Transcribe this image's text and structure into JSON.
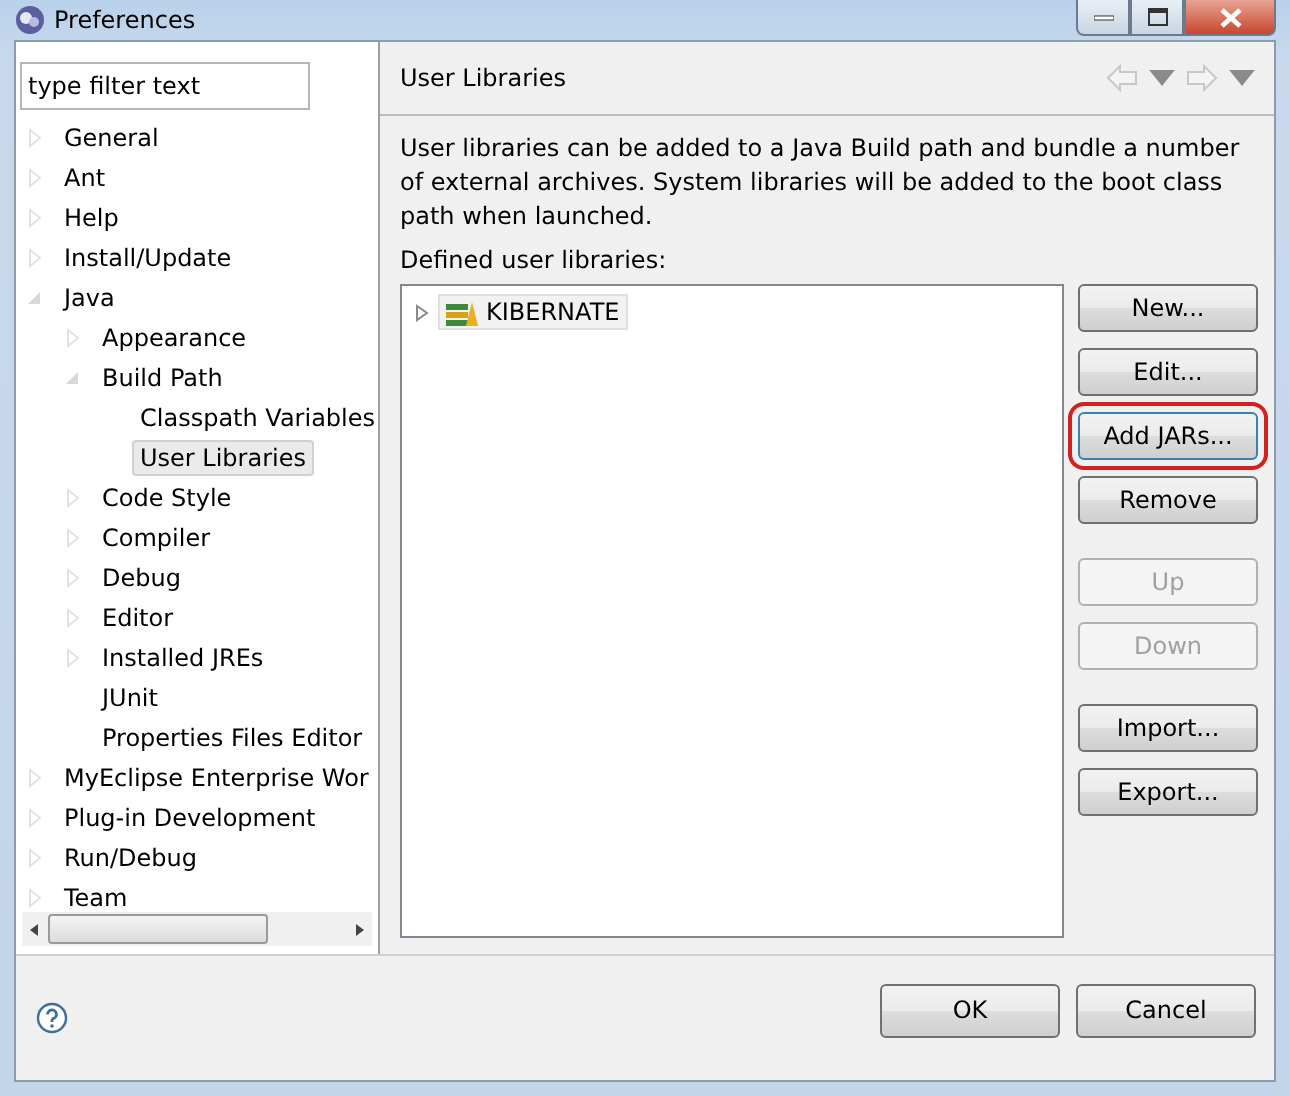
{
  "window": {
    "title": "Preferences"
  },
  "filter": {
    "placeholder": "type filter text"
  },
  "tree": [
    {
      "label": "General",
      "expanded": false,
      "selected": false
    },
    {
      "label": "Ant",
      "expanded": false,
      "selected": false
    },
    {
      "label": "Help",
      "expanded": false,
      "selected": false
    },
    {
      "label": "Install/Update",
      "expanded": false,
      "selected": false
    },
    {
      "label": "Java",
      "expanded": true,
      "selected": false,
      "children": [
        {
          "label": "Appearance",
          "expanded": false,
          "selected": false
        },
        {
          "label": "Build Path",
          "expanded": true,
          "selected": false,
          "children": [
            {
              "label": "Classpath Variables",
              "selected": false
            },
            {
              "label": "User Libraries",
              "selected": true
            }
          ]
        },
        {
          "label": "Code Style",
          "expanded": false,
          "selected": false
        },
        {
          "label": "Compiler",
          "expanded": false,
          "selected": false
        },
        {
          "label": "Debug",
          "expanded": false,
          "selected": false
        },
        {
          "label": "Editor",
          "expanded": false,
          "selected": false
        },
        {
          "label": "Installed JREs",
          "expanded": false,
          "selected": false
        },
        {
          "label": "JUnit",
          "selected": false
        },
        {
          "label": "Properties Files Editor",
          "selected": false
        }
      ]
    },
    {
      "label": "MyEclipse Enterprise Wor",
      "expanded": false,
      "selected": false
    },
    {
      "label": "Plug-in Development",
      "expanded": false,
      "selected": false
    },
    {
      "label": "Run/Debug",
      "expanded": false,
      "selected": false
    },
    {
      "label": "Team",
      "expanded": false,
      "selected": false
    }
  ],
  "page": {
    "title": "User Libraries",
    "description": "User libraries can be added to a Java Build path and bundle a number of external archives. System libraries will be added to the boot class path when launched.",
    "list_label": "Defined user libraries:",
    "libraries": [
      {
        "label": "KIBERNATE",
        "expanded": false
      }
    ],
    "buttons": [
      {
        "label": "New...",
        "disabled": false,
        "highlighted": false
      },
      {
        "label": "Edit...",
        "disabled": false,
        "highlighted": false
      },
      {
        "label": "Add JARs...",
        "disabled": false,
        "highlighted": true
      },
      {
        "label": "Remove",
        "disabled": false,
        "highlighted": false
      },
      {
        "label": "Up",
        "disabled": true,
        "highlighted": false
      },
      {
        "label": "Down",
        "disabled": true,
        "highlighted": false
      },
      {
        "label": "Import...",
        "disabled": false,
        "highlighted": false
      },
      {
        "label": "Export...",
        "disabled": false,
        "highlighted": false
      }
    ]
  },
  "dialog_buttons": [
    "OK",
    "Cancel"
  ]
}
